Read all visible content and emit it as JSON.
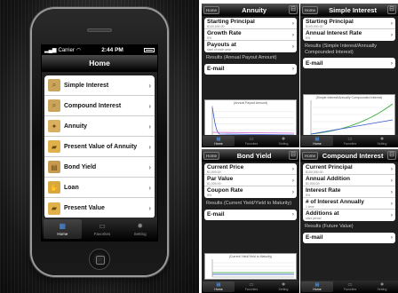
{
  "home_device": {
    "status": {
      "carrier": "Carrier",
      "time": "2:44 PM"
    },
    "nav_title": "Home",
    "menu": [
      {
        "label": "Simple Interest",
        "icon": "magnifier-icon",
        "color": "#c9a45a"
      },
      {
        "label": "Compound Interest",
        "icon": "magnifier-icon",
        "color": "#c9a45a"
      },
      {
        "label": "Annuity",
        "icon": "gear-icon",
        "color": "#d8b060"
      },
      {
        "label": "Present Value of Annuity",
        "icon": "folder-icon",
        "color": "#e0b04a"
      },
      {
        "label": "Bond Yield",
        "icon": "document-icon",
        "color": "#c89a50"
      },
      {
        "label": "Loan",
        "icon": "hand-icon",
        "color": "#d8a840"
      },
      {
        "label": "Present Value",
        "icon": "folder-icon",
        "color": "#e0b04a"
      }
    ],
    "tabs": [
      "Home",
      "Favorites",
      "Setting"
    ]
  },
  "panels": {
    "annuity": {
      "home": "Home",
      "title": "Annuity",
      "fields": [
        {
          "label": "Starting Principal",
          "hint": "$100,000.00"
        },
        {
          "label": "Growth Rate",
          "hint": "5%"
        },
        {
          "label": "Payouts at",
          "hint": "start of each year"
        }
      ],
      "results": "Results (Annual Payout Amount)",
      "email": "E-mail",
      "chart_title": "(Annual Payout Amount)",
      "tabs": [
        "Home",
        "Favorites",
        "Setting"
      ]
    },
    "simple": {
      "home": "Home",
      "title": "Simple Interest",
      "fields": [
        {
          "label": "Starting Principal",
          "hint": "$100,000.00"
        },
        {
          "label": "Annual Interest Rate",
          "hint": "5%"
        }
      ],
      "results": "Results (Simple Interest/Annually Compounded Interest)",
      "email": "E-mail",
      "chart_title": "(Simple Interest/Annually Compounded Interest)",
      "tabs": [
        "Home",
        "Favorites",
        "Setting"
      ]
    },
    "bond": {
      "home": "Home",
      "title": "Bond Yield",
      "fields": [
        {
          "label": "Current Price",
          "hint": "$1,000.00"
        },
        {
          "label": "Par Value",
          "hint": "$1,000.00"
        },
        {
          "label": "Coupon Rate",
          "hint": "5%"
        }
      ],
      "results": "Results (Current Yield/Yield to Maturity)",
      "email": "E-mail",
      "chart_title": "(Current Yield/Yield to Maturity)",
      "tabs": [
        "Home",
        "Favorites",
        "Setting"
      ]
    },
    "compound": {
      "home": "Home",
      "title": "Compound Interest",
      "fields": [
        {
          "label": "Current Principal",
          "hint": "$100,000.00"
        },
        {
          "label": "Annual Addition",
          "hint": "$1,000.00"
        },
        {
          "label": "Interest Rate",
          "hint": "5%"
        },
        {
          "label": "# of Interest Annually",
          "hint": "1 time"
        },
        {
          "label": "Additions at",
          "hint": "start period"
        }
      ],
      "results": "Results (Future Value)",
      "email": "E-mail",
      "chart_title": "(Future Value)",
      "tabs": [
        "Home",
        "Favorites",
        "Setting"
      ]
    }
  },
  "icons": {
    "chevron": "chevron-right-icon",
    "bookmark": "book-icon"
  }
}
